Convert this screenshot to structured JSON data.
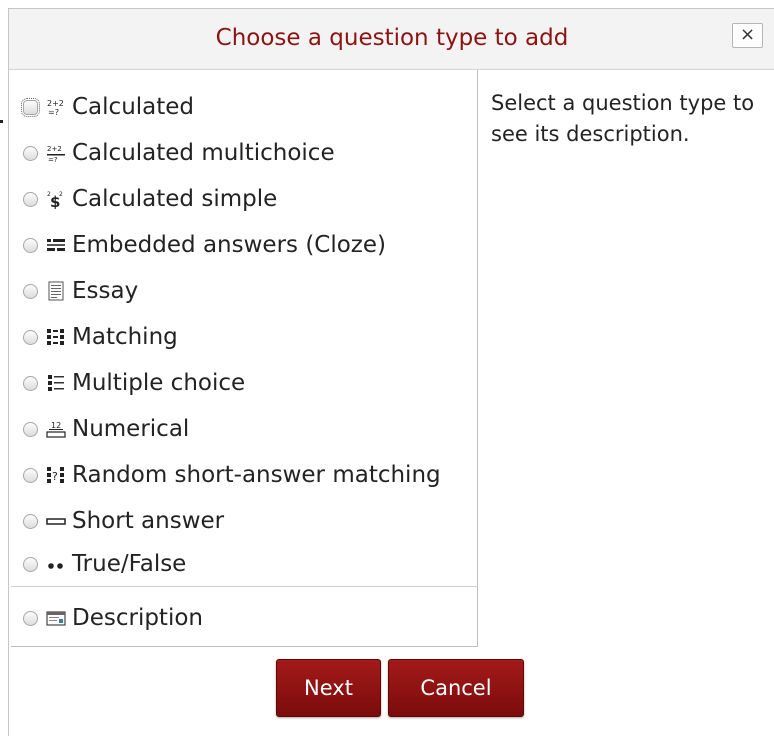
{
  "dialog": {
    "title": "Choose a question type to add",
    "close_label": "×"
  },
  "options": [
    {
      "label": "Calculated",
      "icon": "calculated-icon",
      "focused": true
    },
    {
      "label": "Calculated multichoice",
      "icon": "calculated-multichoice-icon"
    },
    {
      "label": "Calculated simple",
      "icon": "calculated-simple-icon"
    },
    {
      "label": "Embedded answers (Cloze)",
      "icon": "cloze-icon"
    },
    {
      "label": "Essay",
      "icon": "essay-icon"
    },
    {
      "label": "Matching",
      "icon": "matching-icon"
    },
    {
      "label": "Multiple choice",
      "icon": "multiple-choice-icon"
    },
    {
      "label": "Numerical",
      "icon": "numerical-icon"
    },
    {
      "label": "Random short-answer matching",
      "icon": "random-short-answer-matching-icon"
    },
    {
      "label": "Short answer",
      "icon": "short-answer-icon"
    },
    {
      "label": "True/False",
      "icon": "true-false-icon"
    },
    {
      "label": "Description",
      "icon": "description-icon"
    }
  ],
  "description_hint": "Select a question type to see its description.",
  "buttons": {
    "next": "Next",
    "cancel": "Cancel"
  },
  "colors": {
    "title": "#8b1413",
    "button": "#8e1211"
  }
}
